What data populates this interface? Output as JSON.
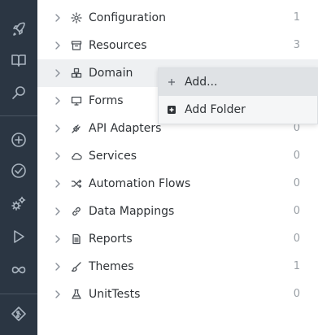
{
  "rail": {
    "items": [
      {
        "icon": "rocket-icon"
      },
      {
        "icon": "book-icon"
      },
      {
        "icon": "search-icon"
      },
      {
        "icon": "add-circle-icon"
      },
      {
        "icon": "check-circle-icon"
      },
      {
        "icon": "gears-icon"
      },
      {
        "icon": "play-icon"
      },
      {
        "icon": "infinity-icon"
      },
      {
        "icon": "git-diamond-icon"
      }
    ]
  },
  "tree": {
    "items": [
      {
        "label": "Configuration",
        "count": "1",
        "icon": "gear-icon"
      },
      {
        "label": "Resources",
        "count": "3",
        "icon": "archive-icon"
      },
      {
        "label": "Domain",
        "count": "",
        "icon": "cubes-icon"
      },
      {
        "label": "Forms",
        "count": "",
        "icon": "monitor-icon"
      },
      {
        "label": "API Adapters",
        "count": "0",
        "icon": "plug-icon"
      },
      {
        "label": "Services",
        "count": "0",
        "icon": "cloud-icon"
      },
      {
        "label": "Automation Flows",
        "count": "0",
        "icon": "shuffle-icon"
      },
      {
        "label": "Data Mappings",
        "count": "0",
        "icon": "link-icon"
      },
      {
        "label": "Reports",
        "count": "0",
        "icon": "document-icon"
      },
      {
        "label": "Themes",
        "count": "1",
        "icon": "brush-icon"
      },
      {
        "label": "UnitTests",
        "count": "0",
        "icon": "flask-icon"
      }
    ]
  },
  "context_menu": {
    "items": [
      {
        "label": "Add...",
        "icon": "plus-icon"
      },
      {
        "label": "Add Folder",
        "icon": "folder-add-icon"
      }
    ]
  },
  "colors": {
    "rail_bg": "#2b3643",
    "rail_icon": "#a9b4bf",
    "row_highlight": "#eef0f2",
    "menu_active": "#dfe2e5"
  }
}
